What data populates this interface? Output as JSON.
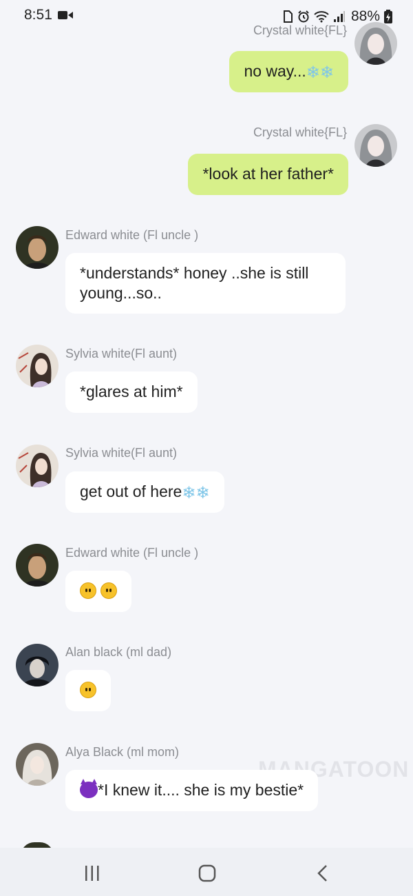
{
  "status_bar": {
    "time": "8:51",
    "battery": "88%",
    "icons": [
      "video-recording-icon",
      "sim-icon",
      "alarm-icon",
      "wifi-icon",
      "signal-icon",
      "battery-charging-icon"
    ]
  },
  "messages": [
    {
      "sender": "Crystal white{FL}",
      "text": "no way...",
      "emoji": [
        "snowflake",
        "snowflake"
      ],
      "direction": "outgoing"
    },
    {
      "sender": "Crystal white{FL}",
      "text": "*look at her father*",
      "direction": "outgoing"
    },
    {
      "sender": "Edward white  (Fl uncle )",
      "text": "*understands* honey ..she is still young...so..",
      "direction": "incoming"
    },
    {
      "sender": "Sylvia white(Fl aunt)",
      "text": "*glares at him*",
      "direction": "incoming"
    },
    {
      "sender": "Sylvia white(Fl aunt)",
      "text": "get out of here",
      "emoji": [
        "snowflake",
        "snowflake"
      ],
      "direction": "incoming"
    },
    {
      "sender": "Edward white  (Fl uncle )",
      "text": "",
      "emoji": [
        "no-mouth-face",
        "no-mouth-face"
      ],
      "direction": "incoming"
    },
    {
      "sender": "Alan black (ml dad)",
      "text": "",
      "emoji": [
        "no-mouth-face"
      ],
      "direction": "incoming"
    },
    {
      "sender": "Alya Black  (ml mom)",
      "text": "*I knew it.... she is my bestie*",
      "emoji": [
        "devil-face"
      ],
      "direction": "incoming"
    }
  ],
  "watermark": "MANGATOON",
  "nav": {
    "recent_icon": "recent-apps-icon",
    "home_icon": "home-icon",
    "back_icon": "back-icon"
  },
  "colors": {
    "background": "#f4f5f9",
    "outgoing_bubble": "#d7f08a",
    "incoming_bubble": "#ffffff",
    "sender_text": "#8b8d92"
  }
}
